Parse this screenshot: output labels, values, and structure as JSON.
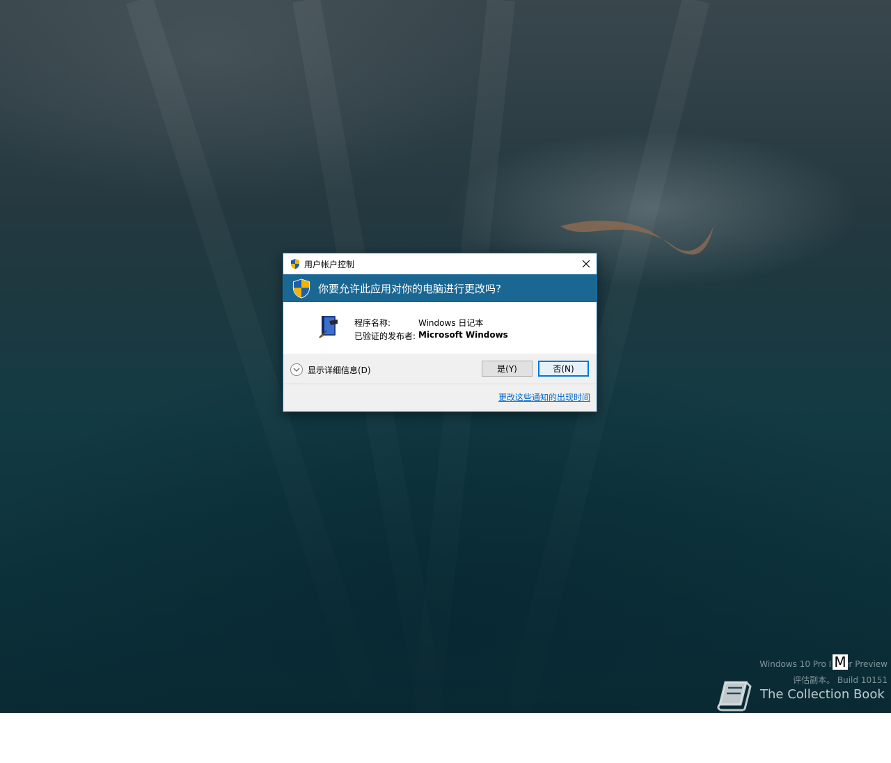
{
  "dialog": {
    "title": "用户帐户控制",
    "question": "你要允许此应用对你的电脑进行更改吗?",
    "program_name_label": "程序名称:",
    "program_name_value": "Windows 日记本",
    "publisher_label": "已验证的发布者:",
    "publisher_value": "Microsoft Windows",
    "show_details_label": "显示详细信息(D)",
    "yes_button": "是(Y)",
    "no_button": "否(N)",
    "change_notification_link": "更改这些通知的出现时间"
  },
  "watermark": {
    "line1_pre": "Windows 10 Pro I",
    "line1_post": "er Preview",
    "overlay_letter": "M",
    "line2": "评估副本。 Build 10151",
    "brand": "The Collection Book"
  },
  "colors": {
    "accent_header": "#1b6793",
    "default_button_border": "#0078d7",
    "link": "#0066cc"
  }
}
